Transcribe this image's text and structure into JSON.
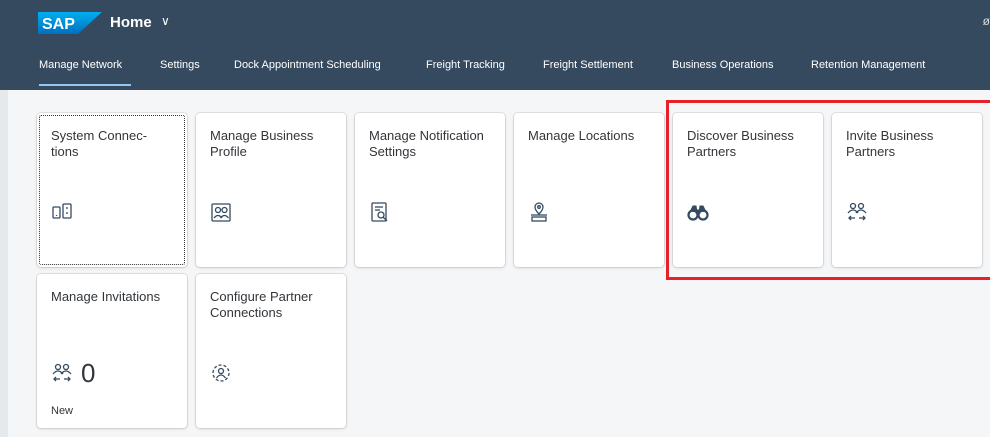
{
  "header": {
    "logo_text": "SAP",
    "title": "Home",
    "chevron": "∨",
    "corner_glyph": "ø"
  },
  "nav": {
    "items": [
      "Manage Network",
      "Settings",
      "Dock Appointment Scheduling",
      "Freight Tracking",
      "Freight Settlement",
      "Business Operations",
      "Retention Management"
    ],
    "active": "Manage Network"
  },
  "tiles": [
    {
      "title": "System Connec-\ntions",
      "icon": "system-connections-icon"
    },
    {
      "title": "Manage Business Profile",
      "icon": "business-profile-icon"
    },
    {
      "title": "Manage Notification Settings",
      "icon": "notification-settings-icon"
    },
    {
      "title": "Manage Locations",
      "icon": "locations-icon"
    },
    {
      "title": "Discover Business Partners",
      "icon": "binoculars-icon"
    },
    {
      "title": "Invite Business Partners",
      "icon": "invite-partners-icon"
    },
    {
      "title": "Manage Invitations",
      "icon": "invitations-icon",
      "number": "0",
      "footer": "New"
    },
    {
      "title": "Configure Partner Connections",
      "icon": "configure-connections-icon"
    }
  ],
  "colors": {
    "shell": "#354a5f",
    "content_bg": "#f5f6f7",
    "highlight": "#e8202a",
    "icon": "#354a5f"
  }
}
